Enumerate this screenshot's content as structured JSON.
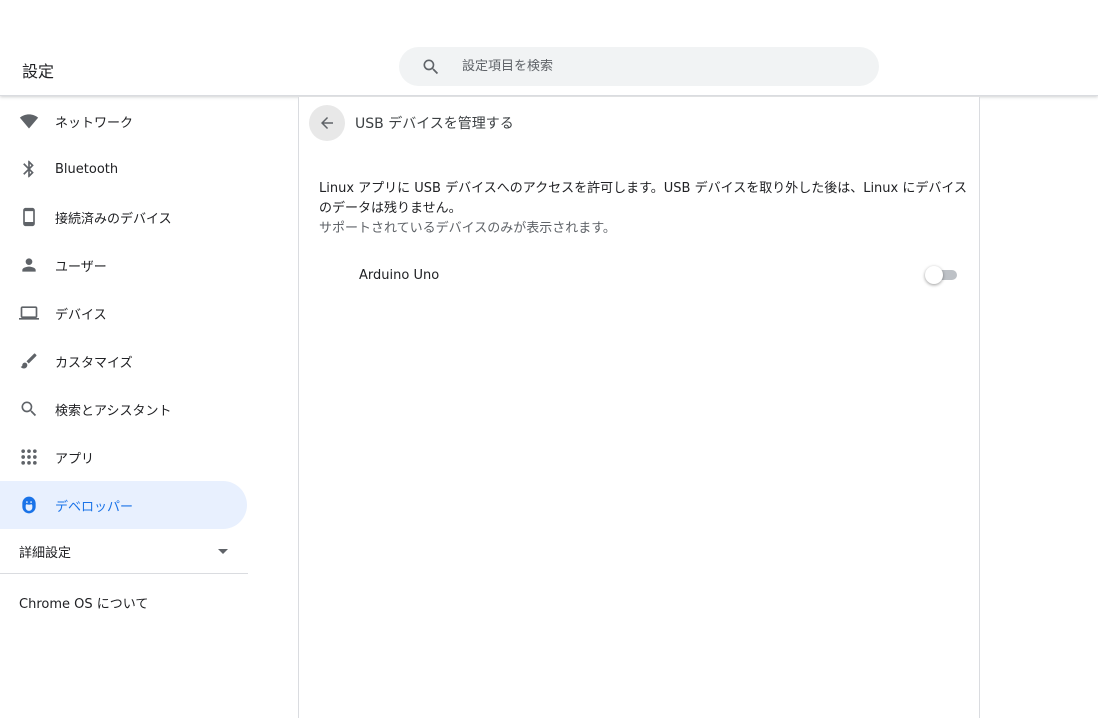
{
  "window": {
    "minimize_icon": "minimize-icon",
    "maximize_icon": "maximize-icon",
    "close_icon": "close-icon"
  },
  "header": {
    "title": "設定",
    "search": {
      "placeholder": "設定項目を検索",
      "value": ""
    }
  },
  "sidebar": {
    "items": [
      {
        "label": "ネットワーク",
        "icon": "wifi-icon"
      },
      {
        "label": "Bluetooth",
        "icon": "bluetooth-icon"
      },
      {
        "label": "接続済みのデバイス",
        "icon": "phone-icon"
      },
      {
        "label": "ユーザー",
        "icon": "person-icon"
      },
      {
        "label": "デバイス",
        "icon": "laptop-icon"
      },
      {
        "label": "カスタマイズ",
        "icon": "brush-icon"
      },
      {
        "label": "検索とアシスタント",
        "icon": "search-icon"
      },
      {
        "label": "アプリ",
        "icon": "apps-grid-icon"
      },
      {
        "label": "デベロッパー",
        "icon": "penguin-icon",
        "active": true
      }
    ],
    "advanced_label": "詳細設定",
    "about_label": "Chrome OS について"
  },
  "main": {
    "title": "USB デバイスを管理する",
    "description": "Linux アプリに USB デバイスへのアクセスを許可します。USB デバイスを取り外した後は、Linux にデバイスのデータは残りません。",
    "note": "サポートされているデバイスのみが表示されます。",
    "devices": [
      {
        "name": "Arduino Uno",
        "enabled": false
      }
    ]
  },
  "colors": {
    "accent": "#1a73e8",
    "active_bg": "#e8f0fe",
    "icon_gray": "#5f6368",
    "search_bg": "#f1f3f4"
  }
}
